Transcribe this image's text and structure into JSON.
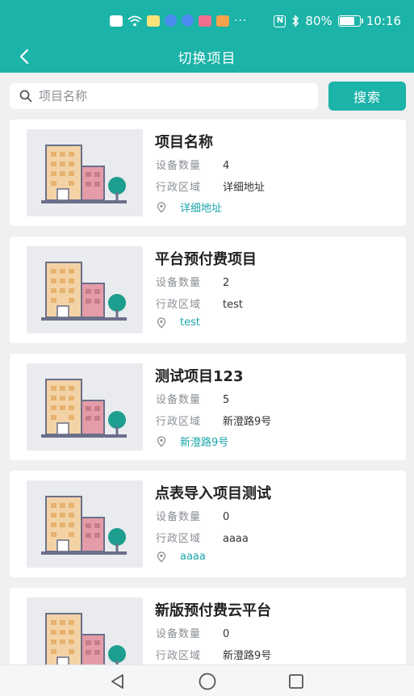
{
  "status_bar": {
    "battery_percent": "80%",
    "battery_level": 0.8,
    "time": "10:16",
    "overflow": "···",
    "nfc_label": "N"
  },
  "nav": {
    "title": "切换项目",
    "back_icon": "chevron-left-icon"
  },
  "search": {
    "placeholder": "项目名称",
    "value": "",
    "button_label": "搜索",
    "icon": "search-icon"
  },
  "projects": [
    {
      "name": "项目名称",
      "device_count_label": "设备数量",
      "device_count": "4",
      "region_label": "行政区域",
      "region": "详细地址",
      "address": "详细地址"
    },
    {
      "name": "平台预付费项目",
      "device_count_label": "设备数量",
      "device_count": "2",
      "region_label": "行政区域",
      "region": "test",
      "address": "test"
    },
    {
      "name": "测试项目123",
      "device_count_label": "设备数量",
      "device_count": "5",
      "region_label": "行政区域",
      "region": "新澄路9号",
      "address": "新澄路9号"
    },
    {
      "name": "点表导入项目测试",
      "device_count_label": "设备数量",
      "device_count": "0",
      "region_label": "行政区域",
      "region": "aaaa",
      "address": "aaaa"
    },
    {
      "name": "新版预付费云平台",
      "device_count_label": "设备数量",
      "device_count": "0",
      "region_label": "行政区域",
      "region": "新澄路9号",
      "address": ""
    }
  ],
  "bottom_nav": {
    "back_icon": "triangle-back-icon",
    "home_icon": "circle-home-icon",
    "recents_icon": "square-recents-icon"
  },
  "colors": {
    "accent": "#1cb3a8",
    "link": "#1aa5a8",
    "background": "#eef0f2"
  }
}
